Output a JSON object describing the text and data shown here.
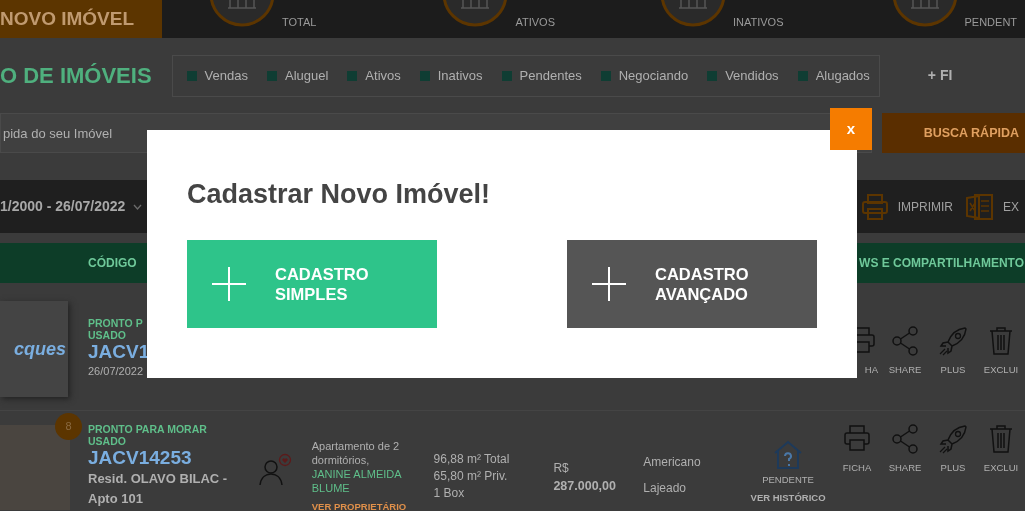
{
  "top_bar": {
    "new_button": "NOVO IMÓVEL",
    "stats": [
      {
        "label": "TOTAL"
      },
      {
        "label": "ATIVOS"
      },
      {
        "label": "INATIVOS"
      },
      {
        "label": "PENDENT"
      }
    ]
  },
  "page_title": "O DE IMÓVEIS",
  "filters": [
    {
      "label": "Vendas",
      "checked": false
    },
    {
      "label": "Aluguel",
      "checked": false
    },
    {
      "label": "Ativos",
      "checked": false
    },
    {
      "label": "Inativos",
      "checked": false
    },
    {
      "label": "Pendentes",
      "checked": false
    },
    {
      "label": "Negociando",
      "checked": false
    },
    {
      "label": "Vendidos",
      "checked": false
    },
    {
      "label": "Alugados",
      "checked": false
    }
  ],
  "more_filters": "+ FI",
  "search": {
    "placeholder": "pida do seu Imóvel",
    "button": "BUSCA RÁPIDA"
  },
  "toolbar": {
    "date_range": "1/2000 - 26/07/2022",
    "print": "IMPRIMIR",
    "export": "EX"
  },
  "table": {
    "columns": [
      "CÓDIGO",
      "WS E COMPARTILHAMENTO"
    ],
    "rows": [
      {
        "kind": "partial",
        "logo": "cques",
        "status": "PRONTO P",
        "condition": "USADO",
        "code": "JACV1",
        "date": "26/07/2022",
        "actions": [
          "HA",
          "SHARE",
          "PLUS",
          "EXCLUI"
        ]
      },
      {
        "kind": "full",
        "badge": "8",
        "status": "PRONTO PARA MORAR",
        "condition": "USADO",
        "code": "JACV14253",
        "address": "Resid. **OLAVO BILAC** - Apto 101",
        "description": "Apartamento de 2 dormitórios,",
        "owner": "JANINE ALMEIDA BLUME",
        "owner_link": "VER PROPRIETÁRIO",
        "areas": [
          "96,88 m² Total",
          "65,80 m² Priv.",
          "1 Box"
        ],
        "price_label": "R$",
        "price": "287.000,00",
        "city": "Americano",
        "region": "Lajeado",
        "state": "PENDENTE",
        "history": "VER HISTÓRICO",
        "actions": [
          "FICHA",
          "SHARE",
          "PLUS",
          "EXCLUI"
        ]
      }
    ]
  },
  "modal": {
    "title": "Cadastrar Novo Imóvel!",
    "close": "x",
    "options": [
      {
        "label": "CADASTRO SIMPLES",
        "kind": "primary"
      },
      {
        "label": "CADASTRO AVANÇADO",
        "kind": "secondary"
      }
    ]
  }
}
